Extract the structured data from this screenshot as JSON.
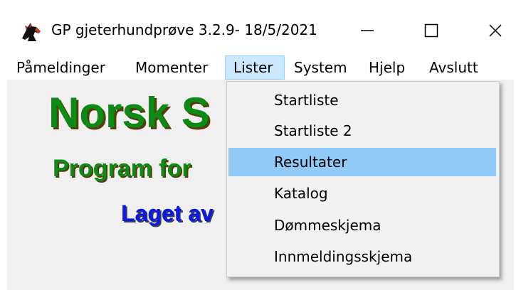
{
  "window": {
    "title": "GP gjeterhundprøve 3.2.9- 18/5/2021",
    "icon": "horse-head-icon",
    "controls": {
      "minimize": "—",
      "maximize": "☐",
      "close": "✕"
    }
  },
  "menubar": {
    "items": [
      {
        "label": "Påmeldinger"
      },
      {
        "label": "Momenter"
      },
      {
        "label": "Lister",
        "active": true
      },
      {
        "label": "System"
      },
      {
        "label": "Hjelp"
      },
      {
        "label": "Avslutt"
      }
    ]
  },
  "lister_menu": {
    "items": [
      {
        "label": "Startliste"
      },
      {
        "label": "Startliste 2"
      },
      {
        "label": "Resultater",
        "highlighted": true
      },
      {
        "label": "Katalog"
      },
      {
        "label": "Dømmeskjema"
      },
      {
        "label": "Innmeldingsskjema"
      }
    ]
  },
  "main": {
    "heading1": "Norsk S",
    "heading2": "Program for",
    "heading3": "Laget av"
  },
  "colors": {
    "heading_green": "#0b8a14",
    "heading_blue": "#0b18e8",
    "menu_highlight": "#91c9f7",
    "menubar_active": "#cce8ff"
  }
}
